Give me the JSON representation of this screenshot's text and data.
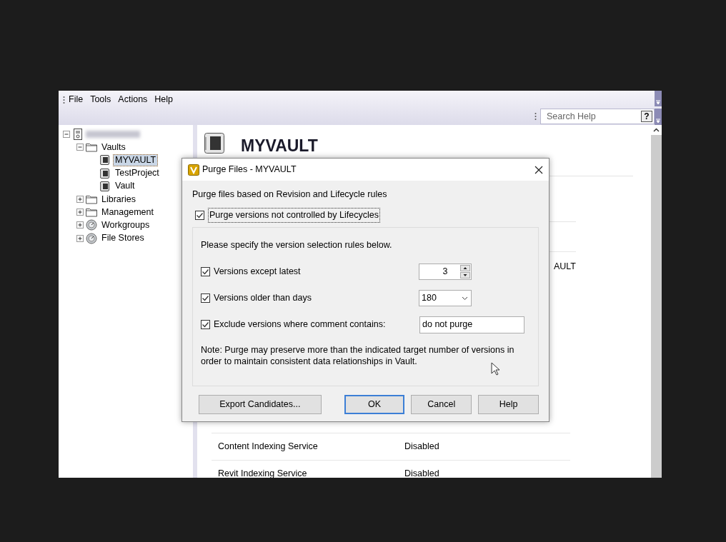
{
  "menu": [
    "File",
    "Tools",
    "Actions",
    "Help"
  ],
  "search": {
    "placeholder": "Search Help",
    "help_key": "?"
  },
  "tree": [
    {
      "kind": "server",
      "expanded": true,
      "selected": false,
      "children": [
        {
          "label": "Vaults",
          "kind": "folder",
          "expanded": true,
          "selected": false,
          "children": [
            {
              "label": "MYVAULT",
              "kind": "vault",
              "selected": true
            },
            {
              "label": "TestProject",
              "kind": "vault",
              "selected": false
            },
            {
              "label": "Vault",
              "kind": "vault",
              "selected": false
            }
          ]
        },
        {
          "label": "Libraries",
          "kind": "folder",
          "expanded": false,
          "selected": false
        },
        {
          "label": "Management",
          "kind": "folder",
          "expanded": false,
          "selected": false
        },
        {
          "label": "Workgroups",
          "kind": "gauge",
          "expanded": false,
          "selected": false
        },
        {
          "label": "File Stores",
          "kind": "gauge",
          "expanded": false,
          "selected": false
        }
      ]
    }
  ],
  "header": {
    "title": "MYVAULT"
  },
  "details": [
    {
      "kind": "covered",
      "value": "AULT"
    },
    {
      "kind": "row",
      "label": "Content Indexing Service",
      "value": "Disabled"
    },
    {
      "kind": "row",
      "label": "Revit Indexing Service",
      "value": "Disabled"
    }
  ],
  "dialog": {
    "title": "Purge Files - MYVAULT",
    "intro": "Purge files based on Revision and Lifecycle rules",
    "main_option": {
      "label": "Purge versions not controlled by Lifecycles",
      "checked": true
    },
    "group_intro": "Please specify the version selection rules below.",
    "rules": [
      {
        "kind": "spin",
        "label": "Versions except latest",
        "checked": true,
        "value": "3"
      },
      {
        "kind": "combo",
        "label": "Versions older than days",
        "checked": true,
        "value": "180"
      },
      {
        "kind": "text",
        "label": "Exclude versions where comment contains:",
        "checked": true,
        "value": "do not purge"
      }
    ],
    "note": "Note: Purge may preserve more than the indicated target number of versions in order to maintain consistent data relationships in Vault.",
    "buttons": [
      {
        "label": "Export Candidates...",
        "default": false
      },
      {
        "label": "OK",
        "default": true
      },
      {
        "label": "Cancel",
        "default": false
      },
      {
        "label": "Help",
        "default": false
      }
    ]
  }
}
